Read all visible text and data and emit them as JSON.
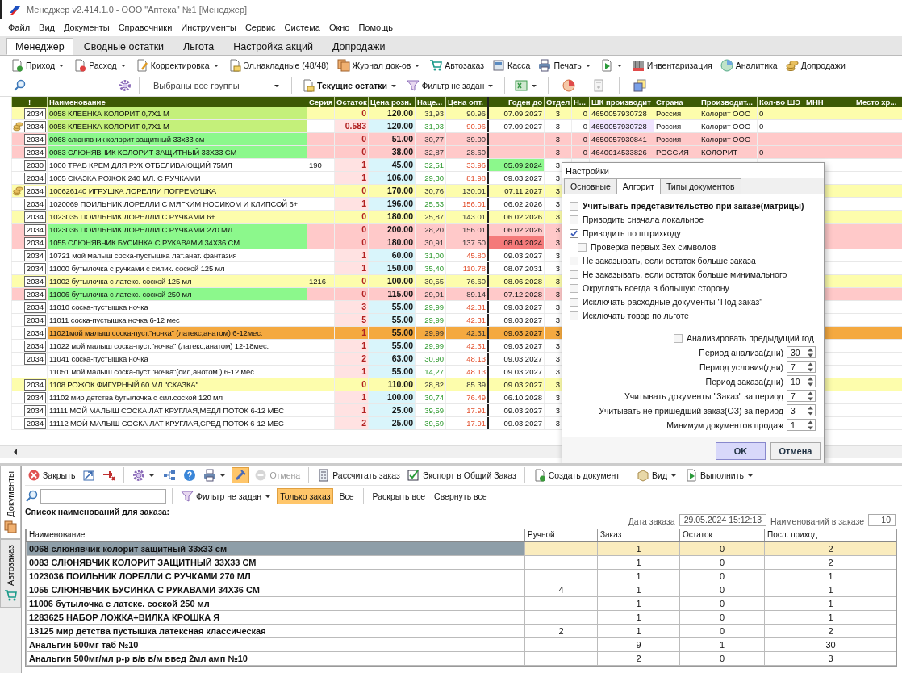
{
  "window": {
    "title": "Менеджер v2.414.1.0 - ООО \"Аптека\" №1 [Менеджер]"
  },
  "menu": [
    "Файл",
    "Вид",
    "Документы",
    "Справочники",
    "Инструменты",
    "Сервис",
    "Система",
    "Окно",
    "Помощь"
  ],
  "tabs": [
    {
      "label": "Менеджер",
      "selected": true
    },
    {
      "label": "Сводные остатки",
      "selected": false
    },
    {
      "label": "Льгота",
      "selected": false
    },
    {
      "label": "Настройка акций",
      "selected": false
    },
    {
      "label": "Допродажи",
      "selected": false
    }
  ],
  "toolbar": [
    {
      "label": "Приход",
      "dropdown": true
    },
    {
      "label": "Расход",
      "dropdown": true
    },
    {
      "label": "Корректировка",
      "dropdown": true
    },
    {
      "label": "Эл.накладные (48/48)",
      "dropdown": false
    },
    {
      "label": "Журнал док-ов",
      "dropdown": true
    },
    {
      "label": "Автозаказ",
      "dropdown": false
    },
    {
      "label": "Касса",
      "dropdown": false
    },
    {
      "label": "Печать",
      "dropdown": true
    },
    {
      "dropdown": true
    },
    {
      "label": "Инвентаризация",
      "dropdown": false
    },
    {
      "label": "Аналитика",
      "dropdown": false
    },
    {
      "label": "Допродажи",
      "dropdown": false
    }
  ],
  "filter_bar": {
    "groups": "Выбраны все группы",
    "stock_mode": "Текущие остатки",
    "filter": "Фильтр не задан"
  },
  "table": {
    "columns": [
      "!",
      "Наименование",
      "Серия",
      "Остаток",
      "Цена розн.",
      "Наце...",
      "Цена опт.",
      "Годен до",
      "Отдел",
      "Н...",
      "ШК производит",
      "Страна",
      "Производит...",
      "Кол-во ШЭ",
      "МНН",
      "Место хр..."
    ],
    "rows": [
      {
        "code": "2034",
        "coins": false,
        "kind": "highlighted",
        "selected": false,
        "name_fill": {
          "color": "#c4f07a"
        },
        "name": "0058 КЛЕЕНКА КОЛОРИТ 0,7Х1 М",
        "stock": "0",
        "price": "120.00",
        "markup": "31,93",
        "wholesale": "90.96",
        "expiry": "07.09.2027",
        "dept": "3",
        "n": "0",
        "barcode": "4650057930728",
        "country": "Россия",
        "maker": "Колорит ООО",
        "units": "0"
      },
      {
        "code": "2034",
        "coins": true,
        "kind": "normal",
        "selected": false,
        "name_fill": {
          "color": "#c4f07a"
        },
        "barcode_fill": {
          "color": "#f0e4ff"
        },
        "name": "0058 КЛЕЕНКА КОЛОРИТ 0,7Х1 М",
        "stock": "0.583",
        "price": "120.00",
        "markup": "31,93",
        "wholesale": "90.96",
        "expiry": "07.09.2027",
        "dept": "3",
        "n": "0",
        "barcode": "4650057930728",
        "country": "Россия",
        "maker": "Колорит ООО",
        "units": "0"
      },
      {
        "code": "2034",
        "coins": false,
        "kind": "alert",
        "selected": false,
        "name_fill": {
          "color": "#8cf88c"
        },
        "name": "0068 слюнявчик колорит защитный 33х33 см",
        "stock": "0",
        "price": "51.00",
        "markup": "30,77",
        "wholesale": "39.00",
        "dept": "3",
        "n": "0",
        "barcode": "4650057930841",
        "country": "Россия",
        "maker": "Колорит ООО"
      },
      {
        "code": "2034",
        "coins": false,
        "kind": "alert",
        "selected": false,
        "name_fill": {
          "color": "#8cf88c"
        },
        "name": "0083 СЛЮНЯВЧИК КОЛОРИТ ЗАЩИТНЫЙ 33Х33 СМ",
        "stock": "0",
        "price": "38.00",
        "markup": "32,87",
        "wholesale": "28.60",
        "dept": "3",
        "n": "0",
        "barcode": "4640014533826",
        "country": "РОССИЯ",
        "maker": "КОЛОРИТ",
        "units": "0"
      },
      {
        "code": "2030",
        "coins": false,
        "kind": "normal",
        "selected": false,
        "date_fill": {
          "color": "#8cf88c"
        },
        "name": "1000 ТРАВ КРЕМ ДЛЯ РУК ОТБЕЛИВАЮЩИЙ 75МЛ",
        "series": "190",
        "stock": "1",
        "price": "45.00",
        "markup": "32,51",
        "wholesale": "33.96",
        "expiry": "05.09.2024",
        "dept": "3"
      },
      {
        "code": "2034",
        "coins": false,
        "kind": "normal",
        "selected": false,
        "name": "1005 СКАЗКА РОЖОК 240 МЛ. С РУЧКАМИ",
        "stock": "1",
        "price": "106.00",
        "markup": "29,30",
        "wholesale": "81.98",
        "expiry": "09.03.2027",
        "dept": "3"
      },
      {
        "code": "2034",
        "coins": true,
        "kind": "highlighted",
        "selected": false,
        "name": "100626140 ИГРУШКА ЛОРЕЛЛИ ПОГРЕМУШКА",
        "stock": "0",
        "price": "170.00",
        "markup": "30,76",
        "wholesale": "130.01",
        "expiry": "07.11.2027",
        "dept": "3"
      },
      {
        "code": "2034",
        "coins": false,
        "kind": "normal",
        "selected": false,
        "name": "1020069 ПОИЛЬНИК ЛОРЕЛЛИ С МЯГКИМ НОСИКОМ И КЛИПСОЙ 6+",
        "stock": "1",
        "price": "196.00",
        "markup": "25,63",
        "wholesale": "156.01",
        "expiry": "06.02.2026",
        "dept": "3"
      },
      {
        "code": "2034",
        "coins": false,
        "kind": "highlighted",
        "selected": false,
        "name": "1023035 ПОИЛЬНИК ЛОРЕЛЛИ С РУЧКАМИ 6+",
        "stock": "0",
        "price": "180.00",
        "markup": "25,87",
        "wholesale": "143.01",
        "expiry": "06.02.2026",
        "dept": "3"
      },
      {
        "code": "2034",
        "coins": false,
        "kind": "alert",
        "selected": false,
        "name_fill": {
          "color": "#8cf88c"
        },
        "name": "1023036 ПОИЛЬНИК ЛОРЕЛЛИ С РУЧКАМИ 270 МЛ",
        "stock": "0",
        "price": "200.00",
        "markup": "28,20",
        "wholesale": "156.01",
        "expiry": "06.02.2026",
        "dept": "3"
      },
      {
        "code": "2034",
        "coins": false,
        "kind": "alert",
        "selected": false,
        "name_fill": {
          "color": "#8cf88c"
        },
        "date_fill": {
          "color": "#f47a7a"
        },
        "name": "1055 СЛЮНЯВЧИК БУСИНКА С РУКАВАМИ 34Х36 СМ",
        "stock": "0",
        "price": "180.00",
        "markup": "30,91",
        "wholesale": "137.50",
        "expiry": "08.04.2024",
        "dept": "3"
      },
      {
        "code": "2034",
        "coins": false,
        "kind": "normal",
        "selected": false,
        "name": "10721 мой малыш соска-пустышка лат.анат. фантазия",
        "stock": "1",
        "price": "60.00",
        "markup": "31,00",
        "wholesale": "45.80",
        "expiry": "09.03.2027",
        "dept": "3"
      },
      {
        "code": "2034",
        "coins": false,
        "kind": "normal",
        "selected": false,
        "name": "11000 бутылочка с ручками с силик. соской 125 мл",
        "stock": "1",
        "price": "150.00",
        "markup": "35,40",
        "wholesale": "110.78",
        "expiry": "08.07.2031",
        "dept": "3"
      },
      {
        "code": "2034",
        "coins": false,
        "kind": "highlighted",
        "selected": false,
        "name": "11002 бутылочка с латекс. соской 125  мл",
        "series": "1216",
        "stock": "0",
        "price": "100.00",
        "markup": "30,55",
        "wholesale": "76.60",
        "expiry": "08.06.2028",
        "dept": "3"
      },
      {
        "code": "2034",
        "coins": false,
        "kind": "alert",
        "selected": false,
        "name_fill": {
          "color": "#8cf88c"
        },
        "name": "11006 бутылочка с латекс. соской 250 мл",
        "stock": "0",
        "price": "115.00",
        "markup": "29,01",
        "wholesale": "89.14",
        "expiry": "07.12.2028",
        "dept": "3"
      },
      {
        "code": "2034",
        "coins": false,
        "kind": "normal",
        "selected": false,
        "name": "11010 соска-пустышка ночка",
        "stock": "3",
        "price": "55.00",
        "markup": "29,99",
        "wholesale": "42.31",
        "expiry": "09.03.2027",
        "dept": "3"
      },
      {
        "code": "2034",
        "coins": false,
        "kind": "normal",
        "selected": false,
        "name": "11011 соска-пустышка ночка 6-12 мес",
        "stock": "5",
        "price": "55.00",
        "markup": "29,99",
        "wholesale": "42.31",
        "expiry": "09.03.2027",
        "dept": "3"
      },
      {
        "code": "2034",
        "coins": false,
        "kind": "normal",
        "selected": true,
        "name": "11021мой малыш соска-пуст.\"ночка\" (латекс,анатом) 6-12мес.",
        "stock": "1",
        "price": "55.00",
        "markup": "29,99",
        "wholesale": "42.31",
        "expiry": "09.03.2027",
        "dept": "3"
      },
      {
        "code": "2034",
        "coins": false,
        "kind": "normal",
        "selected": false,
        "name": "11022 мой малыш соска-пуст.\"ночка\" (латекс,анатом) 12-18мес.",
        "stock": "1",
        "price": "55.00",
        "markup": "29,99",
        "wholesale": "42.31",
        "expiry": "09.03.2027",
        "dept": "3"
      },
      {
        "code": "2034",
        "coins": false,
        "kind": "normal",
        "selected": false,
        "name": "11041 соска-пустышка ночка",
        "stock": "2",
        "price": "63.00",
        "markup": "30,90",
        "wholesale": "48.13",
        "expiry": "09.03.2027",
        "dept": "3"
      },
      {
        "coins": false,
        "kind": "normal",
        "selected": false,
        "name": "11051 мой малыш соска-пуст.\"ночка\"(сил,анотом.) 6-12 мес.",
        "stock": "1",
        "price": "55.00",
        "markup": "14,27",
        "wholesale": "48.13",
        "expiry": "09.03.2027",
        "dept": "3"
      },
      {
        "code": "2034",
        "coins": false,
        "kind": "highlighted",
        "selected": false,
        "name": "1108 РОЖОК ФИГУРНЫЙ 60 МЛ \"СКАЗКА\"",
        "stock": "0",
        "price": "110.00",
        "markup": "28,82",
        "wholesale": "85.39",
        "expiry": "09.03.2027",
        "dept": "3"
      },
      {
        "code": "2034",
        "coins": false,
        "kind": "normal",
        "selected": false,
        "name": "11102 мир детства бутылочка с сил.соской 120 мл",
        "stock": "1",
        "price": "100.00",
        "markup": "30,74",
        "wholesale": "76.49",
        "expiry": "06.10.2028",
        "dept": "3"
      },
      {
        "code": "2034",
        "coins": false,
        "kind": "normal",
        "selected": false,
        "name": "11111 МОЙ МАЛЫШ СОСКА ЛАТ КРУГЛАЯ,МЕДЛ ПОТОК 6-12 МЕС",
        "stock": "1",
        "price": "25.00",
        "markup": "39,59",
        "wholesale": "17.91",
        "expiry": "09.03.2027",
        "dept": "3"
      },
      {
        "code": "2034",
        "coins": false,
        "kind": "normal",
        "selected": false,
        "name": "11112 МОЙ МАЛЫШ СОСКА ЛАТ КРУГЛАЯ,СРЕД ПОТОК 6-12 МЕС",
        "stock": "2",
        "price": "25.00",
        "markup": "39,59",
        "wholesale": "17.91",
        "expiry": "09.03.2027",
        "dept": "3"
      }
    ]
  },
  "dialog": {
    "title": "Настройки",
    "tabs": [
      {
        "label": "Основные",
        "selected": false
      },
      {
        "label": "Алгорит",
        "selected": true
      },
      {
        "label": "Типы документов",
        "selected": false
      }
    ],
    "options": [
      {
        "label": "Учитывать представительство при заказе(матрицы)",
        "kind": "strong",
        "checked": false
      },
      {
        "label": "Приводить сначала локальное",
        "kind": "plain",
        "checked": false
      },
      {
        "label": "Приводить по штрихкоду",
        "kind": "plain",
        "checked": true,
        "children": [
          {
            "label": "Проверка первых 3ех символов",
            "checked": false
          }
        ]
      },
      {
        "label": "Не заказывать, если остаток больше заказа",
        "kind": "plain",
        "checked": false
      },
      {
        "label": "Не заказывать, если остаток больше минимального",
        "kind": "plain",
        "checked": false
      },
      {
        "label": "Округлять всегда в большую сторону",
        "kind": "plain",
        "checked": false
      },
      {
        "label": "Исключать расходные документы \"Под заказ\"",
        "kind": "plain",
        "checked": false
      },
      {
        "label": "Исключать товар по льготе",
        "kind": "plain",
        "checked": false
      }
    ],
    "analyze_previous_year": {
      "label": "Анализировать предыдущий год",
      "checked": false
    },
    "periods": [
      {
        "label": "Период анализа(дни)",
        "value": "30"
      },
      {
        "label": "Период условия(дни)",
        "value": "7"
      },
      {
        "label": "Период заказа(дни)",
        "value": "10"
      },
      {
        "label": "Учитывать документы \"Заказ\" за период",
        "value": "7"
      },
      {
        "label": "Учитывать не пришедший заказ(ОЗ) за период",
        "value": "3"
      },
      {
        "label": "Минимум документов продаж",
        "value": "1"
      }
    ],
    "buttons": [
      {
        "label": "OK",
        "selected": true
      },
      {
        "label": "Отмена",
        "selected": false
      }
    ]
  },
  "side_tabs": [
    {
      "label": "Документы",
      "selected": true
    },
    {
      "label": "Автозаказ",
      "selected": false
    }
  ],
  "order_toolbar": [
    {
      "label": "Закрыть",
      "dropdown": false,
      "selected": false,
      "disabled": false
    },
    {
      "dropdown": false,
      "selected": false,
      "disabled": false
    },
    {
      "dropdown": false,
      "selected": false,
      "disabled": false
    },
    {
      "dropdown": true,
      "selected": false,
      "disabled": false
    },
    {
      "dropdown": false,
      "selected": false,
      "disabled": false
    },
    {
      "dropdown": false,
      "selected": false,
      "disabled": false
    },
    {
      "dropdown": true,
      "selected": false,
      "disabled": false
    },
    {
      "dropdown": false,
      "selected": true,
      "disabled": false
    },
    {
      "label": "Отмена",
      "dropdown": false,
      "selected": false,
      "disabled": true
    },
    {
      "label": "Рассчитать заказ",
      "dropdown": false,
      "selected": false,
      "disabled": false
    },
    {
      "label": "Экспорт в Общий Заказ",
      "dropdown": false,
      "selected": false,
      "disabled": false
    },
    {
      "label": "Создать документ",
      "dropdown": false,
      "selected": false,
      "disabled": false
    },
    {
      "label": "Вид",
      "dropdown": true,
      "selected": false,
      "disabled": false
    },
    {
      "label": "Выполнить",
      "dropdown": true,
      "selected": false,
      "disabled": false
    }
  ],
  "order_filter": {
    "filter": "Фильтр не задан",
    "modes": [
      {
        "label": "Только заказ",
        "selected": true
      },
      {
        "label": "Все",
        "selected": false
      }
    ],
    "expand": "Раскрыть все",
    "collapse": "Свернуть все"
  },
  "order_list": {
    "title": "Список наименований для заказа:",
    "date_label": "Дата заказа",
    "date": "29.05.2024 15:12:13",
    "count_label": "Наименований в заказе",
    "count": "10",
    "columns": [
      "Наименование",
      "Ручной",
      "Заказ",
      "Остаток",
      "Посл. приход"
    ],
    "rows": [
      {
        "name": "0068 слюнявчик колорит защитный 33х33 см",
        "order": "1",
        "rest": "0",
        "last": "2",
        "selected": true
      },
      {
        "name": "0083 СЛЮНЯВЧИК КОЛОРИТ ЗАЩИТНЫЙ 33Х33 СМ",
        "order": "1",
        "rest": "0",
        "last": "2",
        "selected": false
      },
      {
        "name": "1023036 ПОИЛЬНИК ЛОРЕЛЛИ С РУЧКАМИ 270 МЛ",
        "order": "1",
        "rest": "0",
        "last": "1",
        "selected": false
      },
      {
        "name": "1055 СЛЮНЯВЧИК БУСИНКА С РУКАВАМИ 34Х36 СМ",
        "manual": "4",
        "order": "1",
        "rest": "0",
        "last": "1",
        "selected": false
      },
      {
        "name": "11006 бутылочка с латекс. соской 250 мл",
        "order": "1",
        "rest": "0",
        "last": "1",
        "selected": false
      },
      {
        "name": "1283625 НАБОР ЛОЖКА+ВИЛКА КРОШКА Я",
        "order": "1",
        "rest": "0",
        "last": "1",
        "selected": false
      },
      {
        "name": "13125 мир детства пустышка латексная классическая",
        "manual": "2",
        "order": "1",
        "rest": "0",
        "last": "2",
        "selected": false
      },
      {
        "name": "Анальгин 500мг таб №10",
        "order": "9",
        "rest": "1",
        "last": "30",
        "selected": false
      },
      {
        "name": "Анальгин 500мг/мл р-р в/в в/м введ 2мл амп №10",
        "order": "2",
        "rest": "0",
        "last": "3",
        "selected": false
      }
    ]
  }
}
